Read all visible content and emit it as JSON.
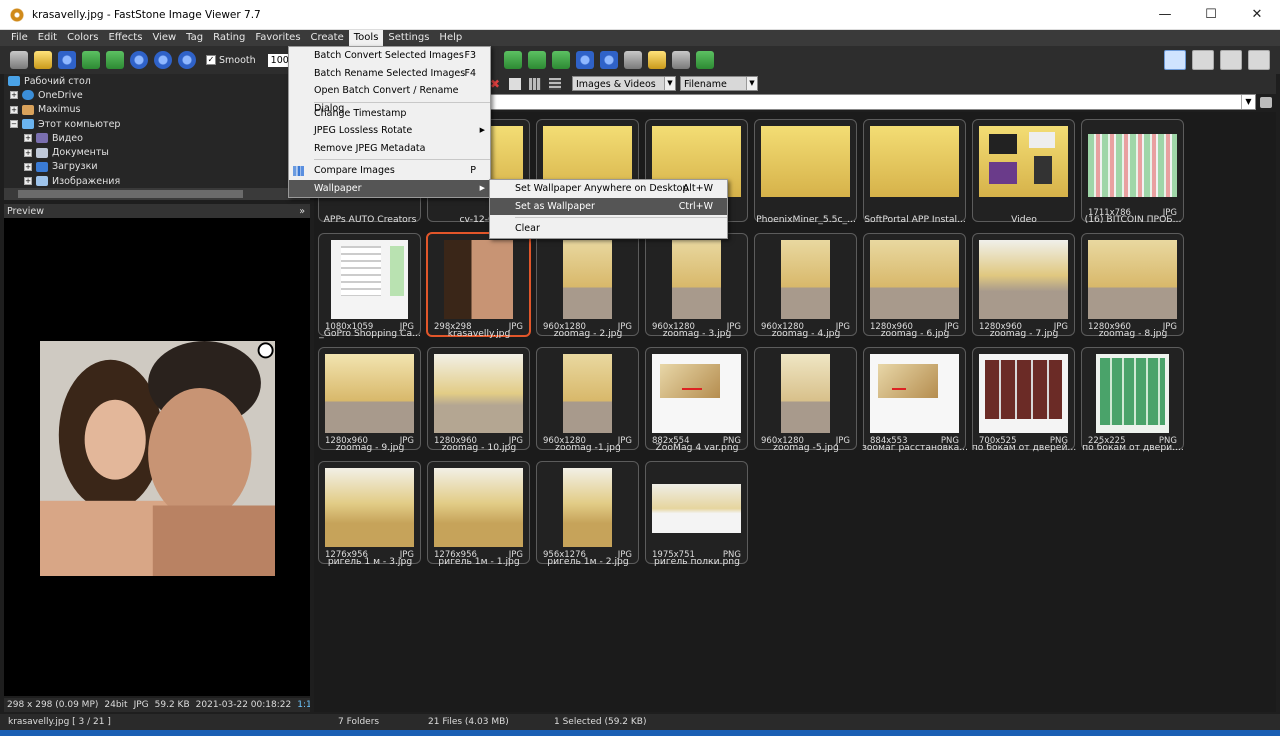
{
  "window": {
    "title": "krasavelly.jpg  -  FastStone Image Viewer 7.7",
    "minimize": "—",
    "maximize": "☐",
    "close": "✕"
  },
  "menubar": [
    "File",
    "Edit",
    "Colors",
    "Effects",
    "View",
    "Tag",
    "Rating",
    "Favorites",
    "Create",
    "Tools",
    "Settings",
    "Help"
  ],
  "toolbar": {
    "smooth_label": "Smooth",
    "smooth_checked": true,
    "zoom_value": "100"
  },
  "browser": {
    "filter": "Images & Videos",
    "sort": "Filename"
  },
  "tree": [
    {
      "label": "Рабочий стол",
      "icon": "desktop-icon",
      "expander": ""
    },
    {
      "label": "OneDrive",
      "icon": "cloud-icon",
      "expander": "+"
    },
    {
      "label": "Maximus",
      "icon": "user-icon",
      "expander": "+"
    },
    {
      "label": "Этот компьютер",
      "icon": "computer-icon",
      "expander": "−"
    },
    {
      "label": "Видео",
      "icon": "video-folder-icon",
      "expander": "+"
    },
    {
      "label": "Документы",
      "icon": "documents-folder-icon",
      "expander": "+"
    },
    {
      "label": "Загрузки",
      "icon": "downloads-folder-icon",
      "expander": "+"
    },
    {
      "label": "Изображения",
      "icon": "pictures-folder-icon",
      "expander": "+"
    }
  ],
  "preview": {
    "header": "Preview",
    "collapse": "»"
  },
  "image_info": {
    "size": "298 x 298 (0.09 MP)",
    "depth": "24bit",
    "format": "JPG",
    "filesize": "59.2 KB",
    "date": "2021-03-22 00:18:22",
    "ratio": "1:1"
  },
  "tools_menu": {
    "items": [
      {
        "label": "Batch Convert Selected Images",
        "shortcut": "F3"
      },
      {
        "label": "Batch Rename Selected Images",
        "shortcut": "F4"
      },
      {
        "label": "Open Batch Convert / Rename Dialog",
        "shortcut": ""
      },
      {
        "label": "Change Timestamp",
        "shortcut": ""
      },
      {
        "label": "JPEG Lossless Rotate",
        "shortcut": "",
        "submenu": "▶"
      },
      {
        "label": "Remove JPEG Metadata",
        "shortcut": ""
      },
      {
        "label": "Compare Images",
        "shortcut": "P"
      },
      {
        "label": "Wallpaper",
        "shortcut": "",
        "submenu": "▶"
      }
    ]
  },
  "wallpaper_menu": {
    "items": [
      {
        "label": "Set Wallpaper Anywhere on Desktop",
        "shortcut": "Alt+W"
      },
      {
        "label": "Set as Wallpaper",
        "shortcut": "Ctrl+W"
      },
      {
        "label": "Clear",
        "shortcut": ""
      }
    ]
  },
  "thumbnails": [
    {
      "caption": "APPs AUTO Creators",
      "dims": "",
      "fmt": ""
    },
    {
      "caption": "cv-12-6_",
      "dims": "",
      "fmt": ""
    },
    {
      "caption": "",
      "dims": "",
      "fmt": ""
    },
    {
      "caption": "",
      "dims": "",
      "fmt": ""
    },
    {
      "caption": "PhoenixMiner_5.5c_...",
      "dims": "",
      "fmt": ""
    },
    {
      "caption": "SoftPortal APP Instal...",
      "dims": "",
      "fmt": ""
    },
    {
      "caption": "Video",
      "dims": "",
      "fmt": ""
    },
    {
      "caption": "(16) BITCOIN ПРОБ...",
      "dims": "1711x786",
      "fmt": "JPG"
    },
    {
      "caption": "_GoPro Shopping Ca...",
      "dims": "1080x1059",
      "fmt": "JPG"
    },
    {
      "caption": "krasavelly.jpg",
      "dims": "298x298",
      "fmt": "JPG"
    },
    {
      "caption": "zoomag - 2.jpg",
      "dims": "960x1280",
      "fmt": "JPG"
    },
    {
      "caption": "zoomag - 3.jpg",
      "dims": "960x1280",
      "fmt": "JPG"
    },
    {
      "caption": "zoomag - 4.jpg",
      "dims": "960x1280",
      "fmt": "JPG"
    },
    {
      "caption": "zoomag - 6.jpg",
      "dims": "1280x960",
      "fmt": "JPG"
    },
    {
      "caption": "zoomag - 7.jpg",
      "dims": "1280x960",
      "fmt": "JPG"
    },
    {
      "caption": "zoomag - 8.jpg",
      "dims": "1280x960",
      "fmt": "JPG"
    },
    {
      "caption": "zoomag - 9.jpg",
      "dims": "1280x960",
      "fmt": "JPG"
    },
    {
      "caption": "zoomag - 10.jpg",
      "dims": "1280x960",
      "fmt": "JPG"
    },
    {
      "caption": "zoomag -1.jpg",
      "dims": "960x1280",
      "fmt": "JPG"
    },
    {
      "caption": "ZooMag 4 var.png",
      "dims": "882x554",
      "fmt": "PNG"
    },
    {
      "caption": "zoomag -5.jpg",
      "dims": "960x1280",
      "fmt": "JPG"
    },
    {
      "caption": "зоомаг расстановка...",
      "dims": "884x553",
      "fmt": "PNG"
    },
    {
      "caption": "по бокам от дверей...",
      "dims": "700x525",
      "fmt": "PNG"
    },
    {
      "caption": "по бокам от двери....",
      "dims": "225x225",
      "fmt": "PNG"
    },
    {
      "caption": "ригель 1 м - 3.jpg",
      "dims": "1276x956",
      "fmt": "JPG"
    },
    {
      "caption": "ригель 1м - 1.jpg",
      "dims": "1276x956",
      "fmt": "JPG"
    },
    {
      "caption": "ригель 1м - 2.jpg",
      "dims": "956x1276",
      "fmt": "JPG"
    },
    {
      "caption": "ригель полки.png",
      "dims": "1975x751",
      "fmt": "PNG"
    }
  ],
  "status": {
    "file": "krasavelly.jpg [ 3 / 21 ]",
    "folders": "7 Folders",
    "files": "21 Files (4.03 MB)",
    "selected": "1 Selected (59.2 KB)"
  },
  "colors": {
    "selection": "#e2562a",
    "menu_highlight": "#555555",
    "background": "#1e1e1e"
  }
}
